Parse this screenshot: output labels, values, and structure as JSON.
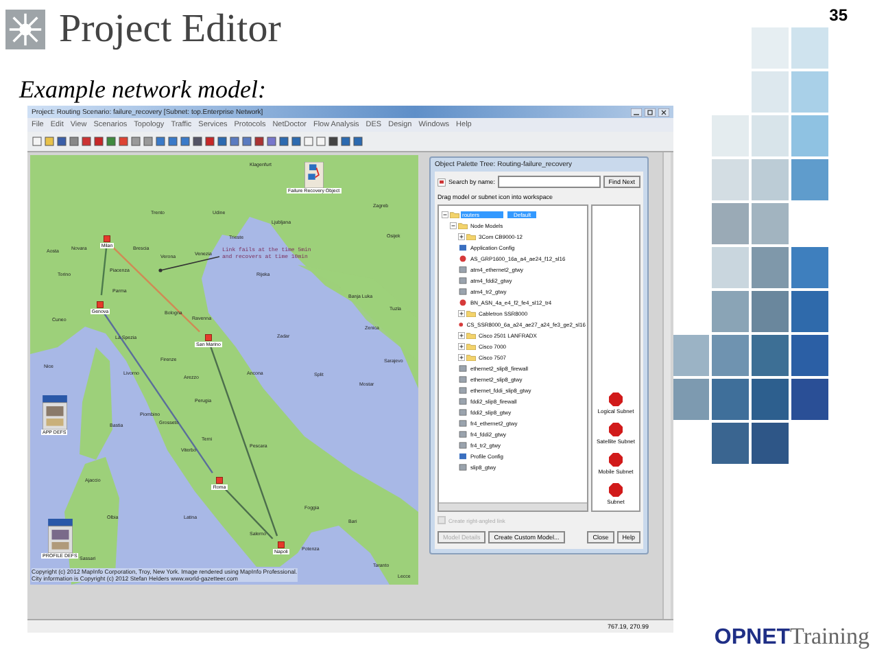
{
  "slide": {
    "title": "Project Editor",
    "page_number": "35",
    "subtitle": "Example network model:",
    "logo": {
      "bold": "OPNET",
      "light": "Training"
    }
  },
  "window": {
    "title": "Project: Routing Scenario: failure_recovery [Subnet: top.Enterprise Network]",
    "menu": [
      "File",
      "Edit",
      "View",
      "Scenarios",
      "Topology",
      "Traffic",
      "Services",
      "Protocols",
      "NetDoctor",
      "Flow Analysis",
      "DES",
      "Design",
      "Windows",
      "Help"
    ],
    "status_bar": "767.19, 270.99"
  },
  "map": {
    "cities": [
      "Klagenfurt",
      "Trento",
      "Udine",
      "Ljubljana",
      "Zagreb",
      "Osijek",
      "Aosta",
      "Novara",
      "Brescia",
      "Verona",
      "Venezia",
      "Trieste",
      "Rijeka",
      "Torino",
      "Piacenza",
      "Parma",
      "Bologna",
      "Ravenna",
      "Cuneo",
      "La Spezia",
      "Banja Luka",
      "Tuzla",
      "Zenica",
      "Zadar",
      "Sarajevo",
      "Nice",
      "Firenze",
      "Arezzo",
      "Ancona",
      "Split",
      "Mostar",
      "Perugia",
      "Livorno",
      "Piombino",
      "Grosseto",
      "Bastia",
      "Terni",
      "Viterbo",
      "Pescara",
      "Ajaccio",
      "Foggia",
      "Bari",
      "Latina",
      "Olbia",
      "Sassari",
      "Potenza",
      "Taranto",
      "Salerno",
      "Lecce"
    ],
    "nodes": [
      {
        "label": "Milan"
      },
      {
        "label": "Genova"
      },
      {
        "label": "San Marino"
      },
      {
        "label": "Roma"
      },
      {
        "label": "Napoli"
      }
    ],
    "annotation": "Link fails at the time 5min and recovers at time 10min",
    "objects": [
      {
        "kind": "recovery",
        "label": "Failure Recovery Object"
      },
      {
        "kind": "application",
        "label": "APP DEFS"
      },
      {
        "kind": "profile",
        "label": "PROFILE DEFS"
      }
    ],
    "copyright": [
      "Copyright (c) 2012 MapInfo Corporation, Troy, New York. Image rendered using MapInfo Professional.",
      "City information is Copyright (c) 2012 Stefan Helders www.world-gazetteer.com"
    ]
  },
  "palette": {
    "title": "Object Palette Tree: Routing-failure_recovery",
    "search_label": "Search by name:",
    "find_button": "Find Next",
    "hint": "Drag model or subnet icon into workspace",
    "filter": "Default",
    "tree": [
      {
        "label": "routers",
        "kind": "folder",
        "expanded": true,
        "selected": true,
        "children": [
          {
            "label": "Node Models",
            "kind": "folder",
            "expanded": true,
            "selected": false,
            "children": [
              {
                "label": "3Com CB9000-12",
                "kind": "folder",
                "expanded": false,
                "selected": false
              },
              {
                "label": "Application Config",
                "kind": "config",
                "selected": false
              },
              {
                "label": "AS_GRP1600_16a_a4_ae24_f12_sl16",
                "kind": "router",
                "selected": false
              },
              {
                "label": "atm4_ethernet2_gtwy",
                "kind": "gateway",
                "selected": false
              },
              {
                "label": "atm4_fddi2_gtwy",
                "kind": "gateway",
                "selected": false
              },
              {
                "label": "atm4_tr2_gtwy",
                "kind": "gateway",
                "selected": false
              },
              {
                "label": "BN_ASN_4a_e4_f2_fe4_sl12_tr4",
                "kind": "router",
                "selected": false
              },
              {
                "label": "Cabletron SSR8000",
                "kind": "folder",
                "expanded": false,
                "selected": false
              },
              {
                "label": "CS_SSR8000_6a_a24_ae27_a24_fe3_ge2_sl16",
                "kind": "router",
                "selected": false
              },
              {
                "label": "Cisco 2501 LANFRADX",
                "kind": "folder",
                "expanded": false,
                "selected": false
              },
              {
                "label": "Cisco 7000",
                "kind": "folder",
                "expanded": false,
                "selected": false
              },
              {
                "label": "Cisco 7507",
                "kind": "folder",
                "expanded": false,
                "selected": false
              },
              {
                "label": "ethernet2_slip8_firewall",
                "kind": "gateway",
                "selected": false
              },
              {
                "label": "ethernet2_slip8_gtwy",
                "kind": "gateway",
                "selected": false
              },
              {
                "label": "ethernet_fddi_slip8_gtwy",
                "kind": "gateway",
                "selected": false
              },
              {
                "label": "fddi2_slip8_firewall",
                "kind": "gateway",
                "selected": false
              },
              {
                "label": "fddi2_slip8_gtwy",
                "kind": "gateway",
                "selected": false
              },
              {
                "label": "fr4_ethernet2_gtwy",
                "kind": "gateway",
                "selected": false
              },
              {
                "label": "fr4_fddi2_gtwy",
                "kind": "gateway",
                "selected": false
              },
              {
                "label": "fr4_tr2_gtwy",
                "kind": "gateway",
                "selected": false
              },
              {
                "label": "Profile Config",
                "kind": "config",
                "selected": false
              },
              {
                "label": "slip8_gtwy",
                "kind": "gateway",
                "selected": false
              }
            ]
          }
        ]
      }
    ],
    "subnets": [
      "Logical Subnet",
      "Satellite Subnet",
      "Mobile Subnet",
      "Subnet"
    ],
    "checkbox": {
      "label": "Create right-angled link",
      "checked": false,
      "disabled": true
    },
    "buttons": [
      {
        "label": "Model Details",
        "disabled": true
      },
      {
        "label": "Create Custom Model...",
        "disabled": false
      },
      {
        "label": "Close",
        "disabled": false
      },
      {
        "label": "Help",
        "disabled": false
      }
    ]
  }
}
